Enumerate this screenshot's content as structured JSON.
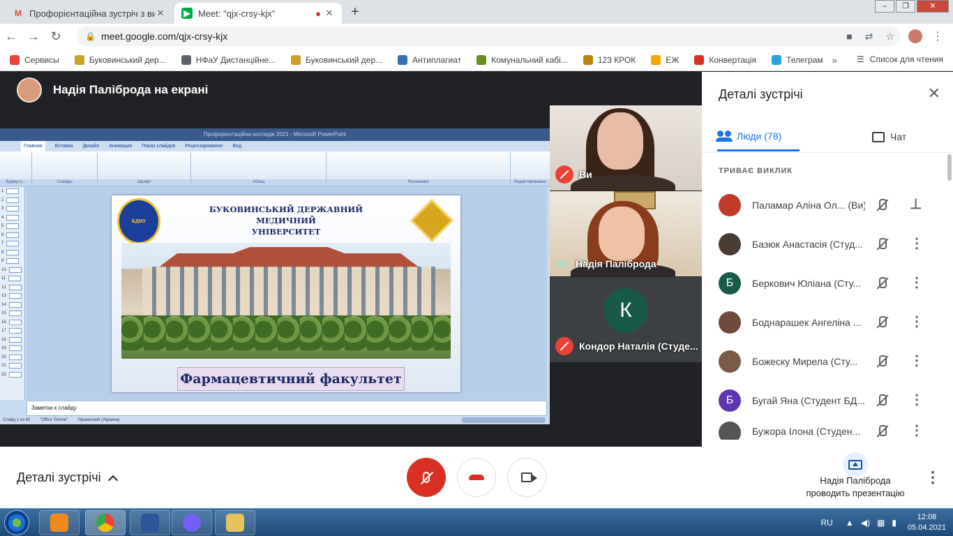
{
  "browser": {
    "tabs": [
      {
        "title": "Профорієнтаційна зустріч з вип",
        "icon": "gmail-icon",
        "active": false
      },
      {
        "title": "Meet: \"qjx-crsy-kjx\"",
        "icon": "google-meet-icon",
        "active": true
      }
    ],
    "url": "meet.google.com/qjx-crsy-kjx",
    "bookmarks": [
      {
        "label": "Сервисы",
        "color": "#ea4335"
      },
      {
        "label": "Буковинський дер...",
        "color": "#c9a227"
      },
      {
        "label": "НФаУ Дистанційне...",
        "color": "#5f6368"
      },
      {
        "label": "Буковинський дер...",
        "color": "#c9a227"
      },
      {
        "label": "Антиплагиат",
        "color": "#3b6fb6"
      },
      {
        "label": "Комунальний кабі...",
        "color": "#6b8e23"
      },
      {
        "label": "123 КРОК",
        "color": "#b8860b"
      },
      {
        "label": "ЕЖ",
        "color": "#f2a900"
      },
      {
        "label": "Конвертація",
        "color": "#d93025"
      },
      {
        "label": "Телеграм",
        "color": "#2aa3df"
      }
    ],
    "more": "»",
    "reading_list": "Список для чтения"
  },
  "stage": {
    "presenter_label": "Надія Палiброда на екрані"
  },
  "slide": {
    "window_title": "Профорієнтаційна колледж 2021 - Microsoft PowerPoint",
    "ribbon_tabs": [
      "Главная",
      "Вставка",
      "Дизайн",
      "Анимация",
      "Показ слайдов",
      "Рецензирование",
      "Вид"
    ],
    "ribbon_groups": [
      "Буфер о...",
      "Слайды",
      "Шрифт",
      "Абзац",
      "Рисование",
      "Редактирование"
    ],
    "university_line1": "БУКОВИНСЬКИЙ ДЕРЖАВНИЙ МЕДИЧНИЙ",
    "university_line2": "УНІВЕРСИТЕТ",
    "logo_text": "БДМУ",
    "faculty": "Фармацевтичний факультет",
    "notes": "Заметки к слайду",
    "status_slide": "Слайд 1 из 42",
    "status_theme": "\"Office Theme\"",
    "status_lang": "Украинский (Украина)",
    "thumb_count": 22
  },
  "tiles": [
    {
      "name": "Ви",
      "mic_off": true
    },
    {
      "name": "Надія Палiброда",
      "speaking": true
    },
    {
      "name": "Кондор Наталія (Студе...",
      "mic_off": true,
      "initial": "К"
    }
  ],
  "panel": {
    "title": "Деталі зустрічі",
    "tab_people": "Люди (78)",
    "tab_chat": "Чат",
    "section": "ТРИВАЄ ВИКЛИК",
    "people": [
      {
        "name": "Паламар Аліна Ол... (Ви)",
        "initial": "",
        "color": "#c0392b",
        "action": "pin-icon"
      },
      {
        "name": "Базюк Анастасія (Студ...",
        "initial": "",
        "color": "#4a3a34",
        "action": "more-vert-icon"
      },
      {
        "name": "Беркович Юліана (Сту...",
        "initial": "Б",
        "color": "#185a47",
        "action": "more-vert-icon"
      },
      {
        "name": "Боднарашек Ангеліна ...",
        "initial": "",
        "color": "#6d4a3c",
        "action": "more-vert-icon"
      },
      {
        "name": "Божеску Мирела (Сту...",
        "initial": "",
        "color": "#7a5a48",
        "action": "more-vert-icon"
      },
      {
        "name": "Бугай Яна (Студент БД...",
        "initial": "Б",
        "color": "#5e35b1",
        "action": "more-vert-icon"
      },
      {
        "name": "Бужора Ілона (Студен...",
        "initial": "",
        "color": "#555",
        "action": "more-vert-icon"
      }
    ]
  },
  "bottombar": {
    "meeting_details": "Деталі зустрічі",
    "presenting_line1": "Надія Палiброда",
    "presenting_line2": "проводить презентацію"
  },
  "taskbar": {
    "lang": "RU",
    "time": "12:08",
    "date": "05.04.2021",
    "apps": [
      {
        "name": "media-player",
        "color": "#f28a1b"
      },
      {
        "name": "chrome",
        "color": "#34a853"
      },
      {
        "name": "word",
        "color": "#2b579a"
      },
      {
        "name": "viber",
        "color": "#7360f2"
      },
      {
        "name": "explorer",
        "color": "#e7c15a"
      }
    ]
  }
}
